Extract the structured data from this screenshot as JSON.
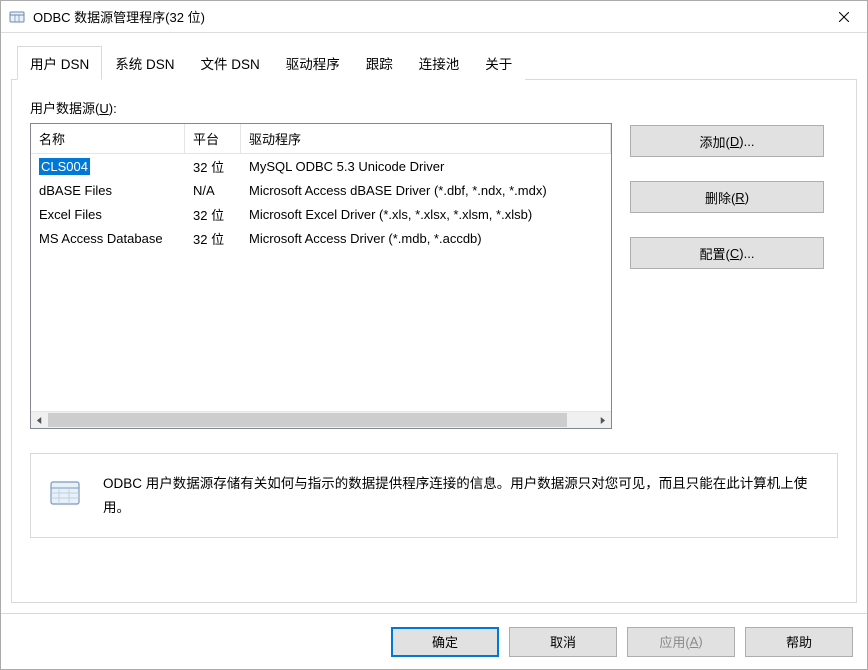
{
  "window": {
    "title": "ODBC 数据源管理程序(32 位)"
  },
  "tabs": [
    {
      "label": "用户 DSN"
    },
    {
      "label": "系统 DSN"
    },
    {
      "label": "文件 DSN"
    },
    {
      "label": "驱动程序"
    },
    {
      "label": "跟踪"
    },
    {
      "label": "连接池"
    },
    {
      "label": "关于"
    }
  ],
  "section": {
    "label_prefix": "用户数据源(",
    "label_ul": "U",
    "label_suffix": "):"
  },
  "columns": {
    "name": "名称",
    "platform": "平台",
    "driver": "驱动程序"
  },
  "rows": [
    {
      "name": "CLS004",
      "platform": "32 位",
      "driver": "MySQL ODBC 5.3 Unicode Driver",
      "selected": true
    },
    {
      "name": "dBASE Files",
      "platform": "N/A",
      "driver": "Microsoft Access dBASE Driver (*.dbf, *.ndx, *.mdx)",
      "selected": false
    },
    {
      "name": "Excel Files",
      "platform": "32 位",
      "driver": "Microsoft Excel Driver (*.xls, *.xlsx, *.xlsm, *.xlsb)",
      "selected": false
    },
    {
      "name": "MS Access Database",
      "platform": "32 位",
      "driver": "Microsoft Access Driver (*.mdb, *.accdb)",
      "selected": false
    }
  ],
  "buttons": {
    "add_prefix": "添加(",
    "add_ul": "D",
    "add_suffix": ")...",
    "remove_prefix": "删除(",
    "remove_ul": "R",
    "remove_suffix": ")",
    "config_prefix": "配置(",
    "config_ul": "C",
    "config_suffix": ")..."
  },
  "info": {
    "text": "ODBC 用户数据源存储有关如何与指示的数据提供程序连接的信息。用户数据源只对您可见，而且只能在此计算机上使用。"
  },
  "bottom": {
    "ok": "确定",
    "cancel": "取消",
    "apply_prefix": "应用(",
    "apply_ul": "A",
    "apply_suffix": ")",
    "help": "帮助"
  }
}
